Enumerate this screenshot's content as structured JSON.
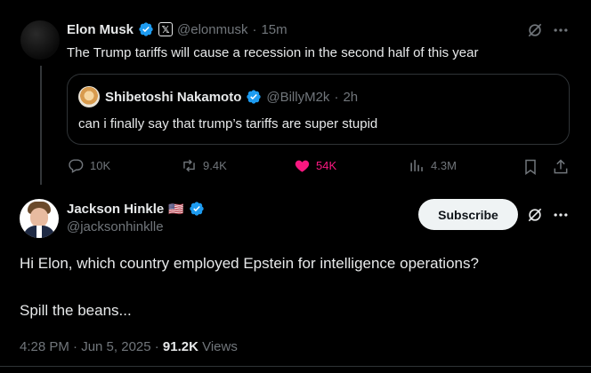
{
  "parent_tweet": {
    "author_name": "Elon Musk",
    "handle": "@elonmusk",
    "time": "15m",
    "separator": "·",
    "text": "The Trump tariffs will cause a recession in the second half of this year",
    "quote": {
      "author_name": "Shibetoshi Nakamoto",
      "handle": "@BillyM2k",
      "time": "2h",
      "separator": "·",
      "text": "can i finally say that trump’s tariffs are super stupid"
    },
    "actions": {
      "replies": "10K",
      "reposts": "9.4K",
      "likes": "54K",
      "views": "4.3M"
    }
  },
  "main_tweet": {
    "author_name": "Jackson Hinkle",
    "flag": "🇺🇸",
    "handle": "@jacksonhinklle",
    "subscribe_label": "Subscribe",
    "line1": "Hi Elon, which country employed Epstein for intelligence operations?",
    "line2": "Spill the beans...",
    "timestamp": "4:28 PM · Jun 5, 2025 · ",
    "views_count": "91.2K",
    "views_label": " Views"
  },
  "colors": {
    "background": "#000000",
    "text": "#e7e9ea",
    "muted": "#71767b",
    "verified_blue": "#1d9bf0",
    "like_pink": "#f91880"
  },
  "icons": [
    "verified-badge-icon",
    "x-logo-icon",
    "grok-icon",
    "more-icon",
    "reply-icon",
    "repost-icon",
    "heart-icon",
    "views-icon",
    "bookmark-icon",
    "share-icon"
  ]
}
